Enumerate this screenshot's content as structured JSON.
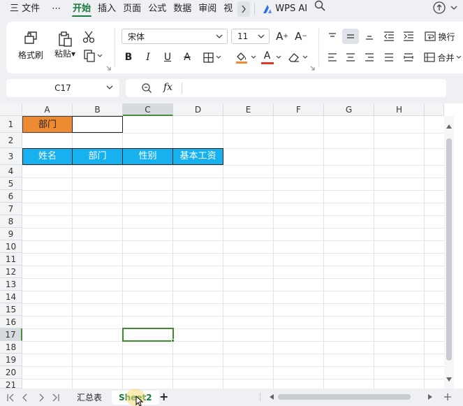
{
  "menu": {
    "items": [
      "三 文件",
      "⋯",
      "开始",
      "插入",
      "页面",
      "公式",
      "数据",
      "审阅",
      "视"
    ],
    "active": "开始",
    "wps_ai": "WPS AI"
  },
  "ribbon": {
    "format_painter": "格式刷",
    "paste": "粘贴",
    "font_name": "宋体",
    "font_size": "11",
    "wrap": "换行",
    "merge": "合并",
    "bold": "B",
    "italic": "I",
    "underline": "U",
    "strike": "A",
    "grow_font": "A",
    "shrink_font": "A",
    "font_color_letter": "A"
  },
  "formula_bar": {
    "name_box": "C17",
    "fx": "fx",
    "content": ""
  },
  "grid": {
    "columns": [
      "A",
      "B",
      "C",
      "D",
      "E",
      "F",
      "G",
      "H"
    ],
    "selected_column": "C",
    "rows": [
      "1",
      "2",
      "3",
      "4",
      "5",
      "6",
      "7",
      "8",
      "9",
      "10",
      "11",
      "12",
      "13",
      "14",
      "15",
      "16",
      "17",
      "18",
      "19",
      "20",
      "21"
    ],
    "selected_row": "17",
    "cells": {
      "A1": "部门",
      "A3": "姓名",
      "B3": "部门",
      "C3": "性别",
      "D3": "基本工资"
    },
    "colors": {
      "orange_fill": "#ed8a32",
      "blue_fill": "#16b1ee",
      "selection": "#3f8a2e"
    }
  },
  "sheets": {
    "tabs": [
      "汇总表",
      "Sheet2"
    ],
    "active": "Sheet2",
    "add": "+"
  }
}
